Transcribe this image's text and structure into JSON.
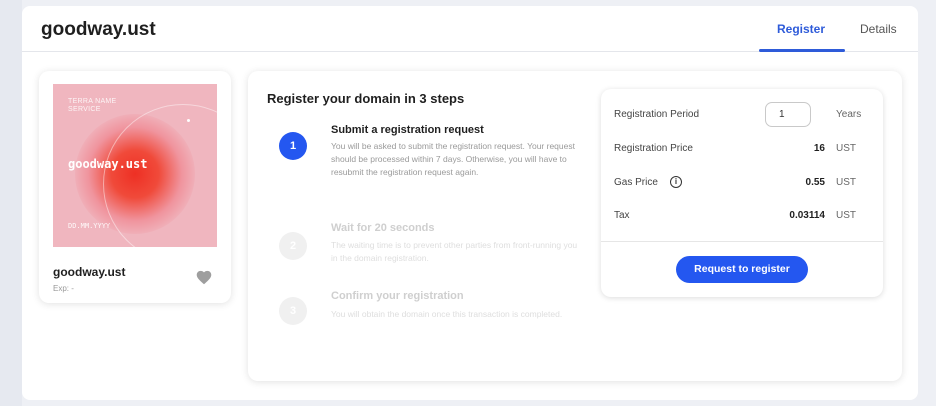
{
  "header": {
    "domain": "goodway.ust",
    "tabs": [
      {
        "label": "Register",
        "active": true
      },
      {
        "label": "Details",
        "active": false
      }
    ]
  },
  "card": {
    "nft_brand": "TERRA NAME SERVICE",
    "nft_name": "goodway.ust",
    "nft_date": "DD.MM.YYYY",
    "name": "goodway.ust",
    "exp": "Exp: -",
    "favorite_icon": "heart-icon"
  },
  "steps": {
    "title": "Register your domain in 3 steps",
    "items": [
      {
        "number": "1",
        "title": "Submit a registration request",
        "description": "You will be asked to submit the registration request. Your request should be processed within 7 days. Otherwise, you will have to resubmit the registration request again.",
        "active": true
      },
      {
        "number": "2",
        "title": "Wait for 20 seconds",
        "description": "The waiting time is to prevent other parties from front-running you in the domain registration.",
        "active": false
      },
      {
        "number": "3",
        "title": "Confirm your registration",
        "description": "You will obtain the domain once this transaction is completed.",
        "active": false
      }
    ]
  },
  "pricing": {
    "period_label": "Registration Period",
    "period_value": "1",
    "period_unit": "Years",
    "price_label": "Registration Price",
    "price_value": "16",
    "price_unit": "UST",
    "gas_label": "Gas Price",
    "gas_value": "0.55",
    "gas_unit": "UST",
    "tax_label": "Tax",
    "tax_value": "0.03114",
    "tax_unit": "UST",
    "button_label": "Request to register"
  },
  "colors": {
    "accent": "#2457f0",
    "tab_active": "#2e5bd9",
    "nft_background": "#f0b6bf",
    "nft_glow": "#ee3024"
  }
}
